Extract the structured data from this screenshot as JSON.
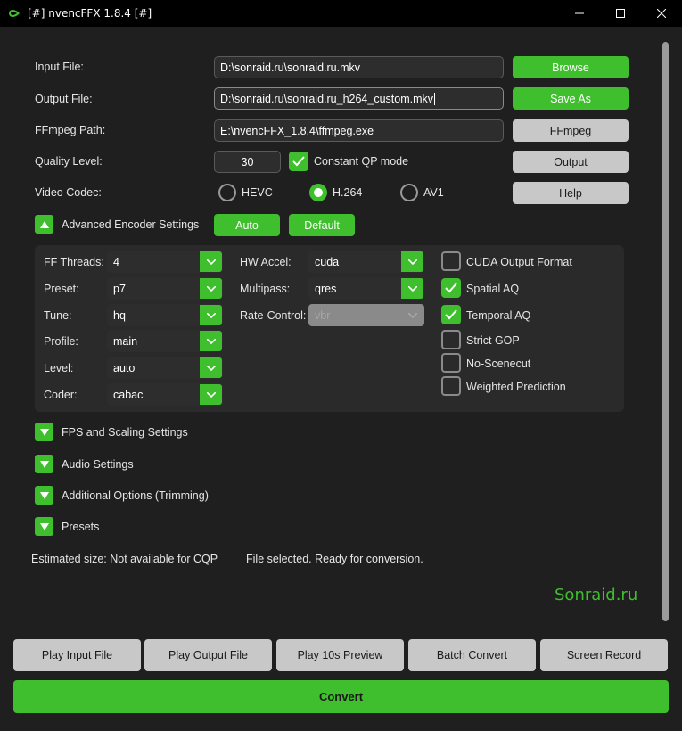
{
  "window": {
    "title": "[#] nvencFFX 1.8.4 [#]",
    "minimize_glyph": "—",
    "maximize_glyph": "☐",
    "close_glyph": "✕"
  },
  "form": {
    "input_label": "Input File:",
    "input_value": "D:\\sonraid.ru\\sonraid.ru.mkv",
    "browse_label": "Browse",
    "output_label": "Output File:",
    "output_value": "D:\\sonraid.ru\\sonraid.ru_h264_custom.mkv",
    "save_as_label": "Save As",
    "ffmpeg_label": "FFmpeg Path:",
    "ffmpeg_value": "E:\\nvencFFX_1.8.4\\ffmpeg.exe",
    "ffmpeg_button": "FFmpeg",
    "quality_label": "Quality Level:",
    "quality_value": "30",
    "cqp_label": "Constant QP mode",
    "cqp_checked": true,
    "output_button": "Output",
    "codec_label": "Video Codec:",
    "codecs": [
      {
        "label": "HEVC",
        "selected": false
      },
      {
        "label": "H.264",
        "selected": true
      },
      {
        "label": "AV1",
        "selected": false
      }
    ],
    "help_button": "Help"
  },
  "advanced": {
    "toggle_label": "Advanced Encoder Settings",
    "auto_label": "Auto",
    "default_label": "Default",
    "ff_threads_label": "FF Threads:",
    "ff_threads_value": "4",
    "preset_label": "Preset:",
    "preset_value": "p7",
    "tune_label": "Tune:",
    "tune_value": "hq",
    "profile_label": "Profile:",
    "profile_value": "main",
    "level_label": "Level:",
    "level_value": "auto",
    "coder_label": "Coder:",
    "coder_value": "cabac",
    "hw_accel_label": "HW Accel:",
    "hw_accel_value": "cuda",
    "multipass_label": "Multipass:",
    "multipass_value": "qres",
    "rate_control_label": "Rate-Control:",
    "rate_control_value": "vbr",
    "checks": [
      {
        "label": "CUDA Output Format",
        "checked": false
      },
      {
        "label": "Spatial AQ",
        "checked": true
      },
      {
        "label": "Temporal AQ",
        "checked": true
      },
      {
        "label": "Strict GOP",
        "checked": false
      },
      {
        "label": "No-Scenecut",
        "checked": false
      },
      {
        "label": "Weighted Prediction",
        "checked": false
      }
    ]
  },
  "sections": {
    "fps": "FPS and Scaling Settings",
    "audio": "Audio Settings",
    "additional": "Additional Options (Trimming)",
    "presets": "Presets"
  },
  "status": {
    "estimated": "Estimated size: Not available for CQP",
    "message": "File selected. Ready for conversion."
  },
  "watermark": "Sonraid.ru",
  "bottom": {
    "play_input": "Play Input File",
    "play_output": "Play Output File",
    "preview": "Play 10s Preview",
    "batch": "Batch Convert",
    "screen_record": "Screen Record",
    "convert": "Convert"
  },
  "colors": {
    "accent": "#3fbf2d",
    "background": "#1f1f1f",
    "panel": "#2a2a2a",
    "button_gray": "#c8c8c8"
  }
}
